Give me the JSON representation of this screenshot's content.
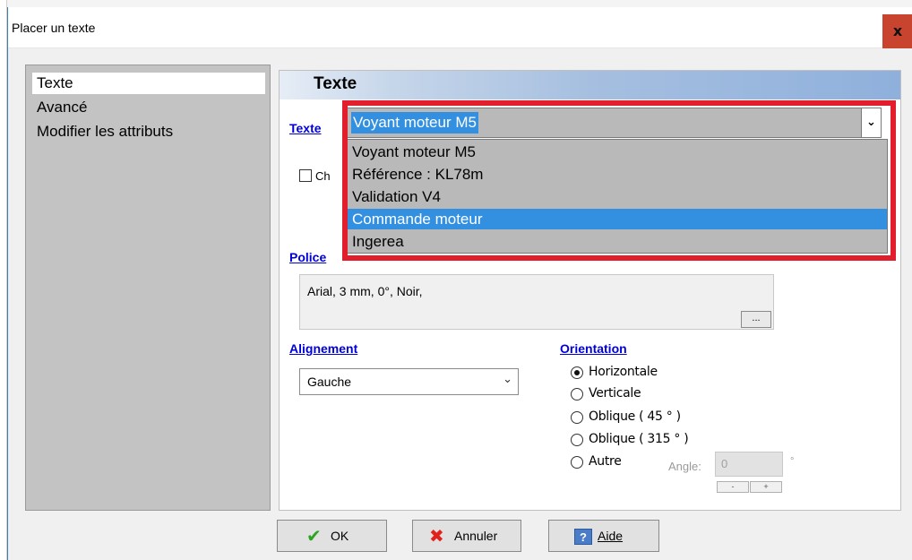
{
  "window": {
    "title": "Placer un texte",
    "close_glyph": "x"
  },
  "nav": {
    "items": [
      {
        "label": "Texte",
        "selected": true
      },
      {
        "label": "Avancé",
        "selected": false
      },
      {
        "label": "Modifier les attributs",
        "selected": false
      }
    ]
  },
  "section": {
    "title": "Texte",
    "text_label": "Texte",
    "text_value": "Voyant moteur M5",
    "checkbox_label": "Ch",
    "dropdown": {
      "items": [
        "Voyant moteur M5",
        "Référence : KL78m",
        "Validation V4",
        "Commande moteur",
        "Ingerea"
      ],
      "highlighted": "Commande moteur"
    },
    "police": {
      "label": "Police",
      "value": "Arial, 3 mm, 0°, Noir,",
      "button": "..."
    },
    "alignement": {
      "label": "Alignement",
      "value": "Gauche"
    },
    "orientation": {
      "label": "Orientation",
      "options": [
        "Horizontale",
        "Verticale",
        "Oblique ( 45 ° )",
        "Oblique ( 315 ° )",
        "Autre"
      ],
      "selected": "Horizontale",
      "angle_label": "Angle:",
      "angle_value": "0",
      "degree_symbol": "°",
      "spin_minus": "-",
      "spin_plus": "+"
    }
  },
  "buttons": {
    "ok": "OK",
    "cancel": "Annuler",
    "help": "Aide",
    "ok_icon": "checkmark-icon",
    "cancel_icon": "red-x-icon",
    "help_icon": "help-question-icon"
  },
  "colors": {
    "highlight": "#3390e0",
    "annotation": "#e31e2c",
    "link": "#0000d8",
    "close_bg": "#c8442f"
  }
}
